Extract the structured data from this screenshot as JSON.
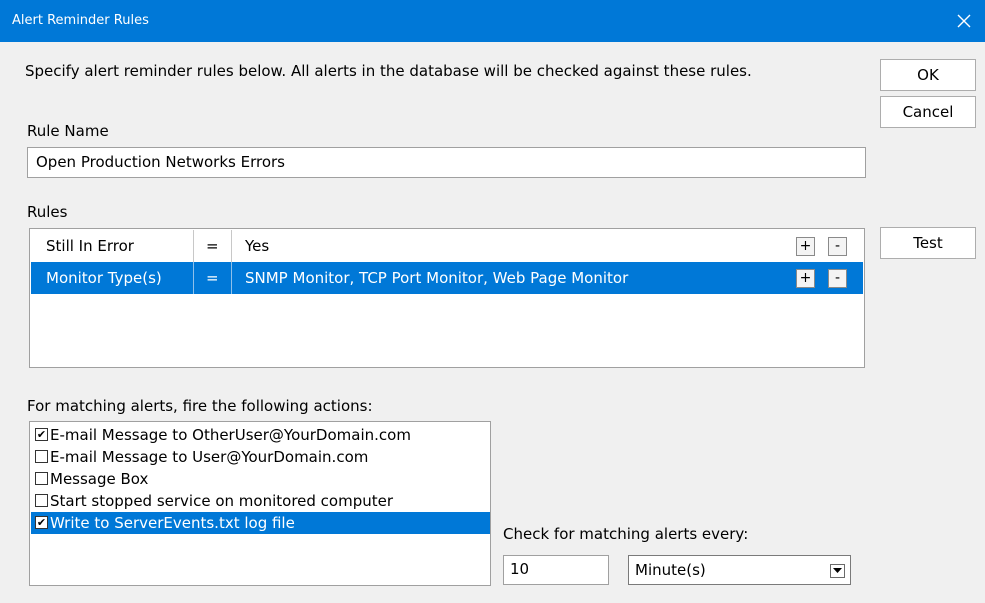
{
  "window": {
    "title": "Alert Reminder Rules"
  },
  "intro_text": "Specify alert reminder rules below.  All alerts in the database will be checked against these rules.",
  "buttons": {
    "ok": "OK",
    "cancel": "Cancel",
    "test": "Test"
  },
  "rule_name": {
    "label": "Rule Name",
    "value": "Open Production Networks Errors"
  },
  "rules": {
    "label": "Rules",
    "rows": [
      {
        "field": "Still In Error",
        "op": "=",
        "value": "Yes",
        "plus": "+",
        "minus": "-",
        "selected": false
      },
      {
        "field": "Monitor Type(s)",
        "op": "=",
        "value": "SNMP Monitor, TCP Port Monitor, Web Page Monitor",
        "plus": "+",
        "minus": "-",
        "selected": true
      }
    ]
  },
  "actions": {
    "label": "For matching alerts, fire the following actions:",
    "items": [
      {
        "label": "E-mail Message to OtherUser@YourDomain.com",
        "checked": true,
        "selected": false,
        "check_glyph": "✔"
      },
      {
        "label": "E-mail Message to User@YourDomain.com",
        "checked": false,
        "selected": false,
        "check_glyph": ""
      },
      {
        "label": "Message Box",
        "checked": false,
        "selected": false,
        "check_glyph": ""
      },
      {
        "label": "Start stopped service on monitored computer",
        "checked": false,
        "selected": false,
        "check_glyph": ""
      },
      {
        "label": "Write to ServerEvents.txt log file",
        "checked": true,
        "selected": true,
        "check_glyph": "✔"
      }
    ]
  },
  "interval": {
    "label": "Check for matching alerts every:",
    "value": "10",
    "unit": "Minute(s)"
  },
  "icons": {
    "close": "close-icon",
    "dropdown": "chevron-down-icon",
    "checkbox": "checkbox-icon"
  },
  "colors": {
    "accent": "#0078d7",
    "background": "#f0f0f0"
  }
}
